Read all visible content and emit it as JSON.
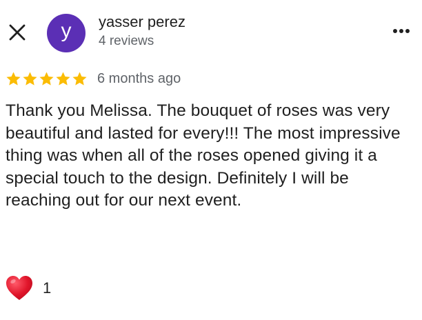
{
  "reviewer": {
    "avatar_letter": "y",
    "name": "yasser perez",
    "review_count": "4 reviews"
  },
  "review": {
    "rating": 5,
    "rating_max": 5,
    "date": "6 months ago",
    "text": "Thank you Melissa. The bouquet of roses was very beautiful and lasted for every!!! The most impressive thing was when all of the roses opened giving it a special touch to the design. Definitely I will be reaching out for our next event."
  },
  "reactions": {
    "heart_count": "1"
  },
  "icons": {
    "close": "close-icon",
    "more": "more-vert-icon",
    "star": "star-icon",
    "heart": "heart-icon"
  },
  "colors": {
    "avatar_bg": "#5b2fb5",
    "star": "#fbbc04",
    "heart": "#e0152a",
    "secondary_text": "#5f6368"
  }
}
